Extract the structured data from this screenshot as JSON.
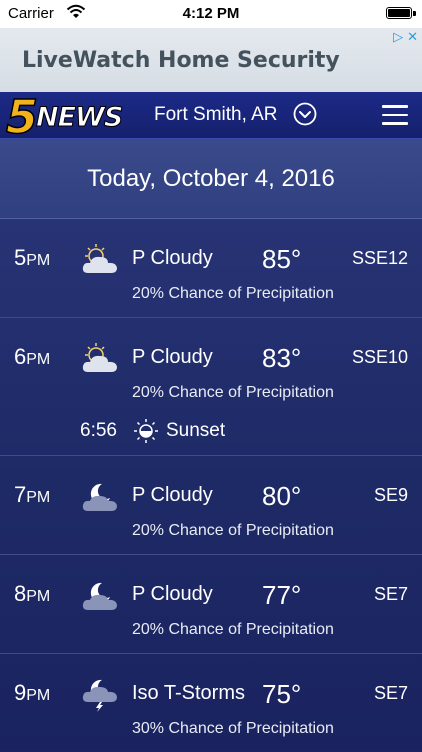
{
  "status_bar": {
    "carrier": "Carrier",
    "time": "4:12 PM"
  },
  "ad": {
    "text": "LiveWatch Home Security"
  },
  "header": {
    "logo_number": "5",
    "logo_word": "NEWS",
    "location": "Fort Smith, AR"
  },
  "date": "Today, October 4, 2016",
  "hours": [
    {
      "hour": "5",
      "ampm": "PM",
      "icon": "partly-cloudy-day-icon",
      "condition": "P Cloudy",
      "temp": "85°",
      "wind": "SSE12",
      "precip": "20% Chance of Precipitation"
    },
    {
      "hour": "6",
      "ampm": "PM",
      "icon": "partly-cloudy-day-icon",
      "condition": "P Cloudy",
      "temp": "83°",
      "wind": "SSE10",
      "precip": "20% Chance of Precipitation",
      "sun_event": {
        "time": "6:56",
        "label": "Sunset"
      }
    },
    {
      "hour": "7",
      "ampm": "PM",
      "icon": "partly-cloudy-night-icon",
      "condition": "P Cloudy",
      "temp": "80°",
      "wind": "SE9",
      "precip": "20% Chance of Precipitation"
    },
    {
      "hour": "8",
      "ampm": "PM",
      "icon": "partly-cloudy-night-icon",
      "condition": "P Cloudy",
      "temp": "77°",
      "wind": "SE7",
      "precip": "20% Chance of Precipitation"
    },
    {
      "hour": "9",
      "ampm": "PM",
      "icon": "thunderstorm-night-icon",
      "condition": "Iso T-Storms",
      "temp": "75°",
      "wind": "SE7",
      "precip": "30% Chance of Precipitation"
    }
  ]
}
